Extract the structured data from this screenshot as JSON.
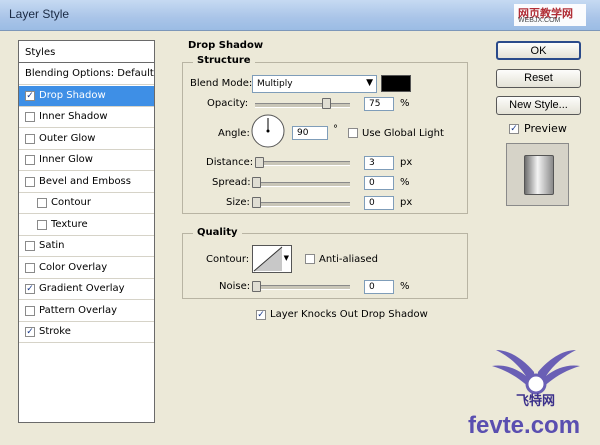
{
  "window": {
    "title": "Layer Style"
  },
  "watermark": {
    "top_line1": "网页教学网",
    "top_line2": "WEBJX.COM",
    "bottom_text": "fevte.com",
    "bottom_cn": "飞特网"
  },
  "styles_panel": {
    "header": "Styles",
    "items": [
      {
        "label": "Blending Options: Default",
        "checkbox": false,
        "checked": false,
        "indent": false,
        "selected": false
      },
      {
        "label": "Drop Shadow",
        "checkbox": true,
        "checked": true,
        "indent": false,
        "selected": true
      },
      {
        "label": "Inner Shadow",
        "checkbox": true,
        "checked": false,
        "indent": false,
        "selected": false
      },
      {
        "label": "Outer Glow",
        "checkbox": true,
        "checked": false,
        "indent": false,
        "selected": false
      },
      {
        "label": "Inner Glow",
        "checkbox": true,
        "checked": false,
        "indent": false,
        "selected": false
      },
      {
        "label": "Bevel and Emboss",
        "checkbox": true,
        "checked": false,
        "indent": false,
        "selected": false
      },
      {
        "label": "Contour",
        "checkbox": true,
        "checked": false,
        "indent": true,
        "selected": false
      },
      {
        "label": "Texture",
        "checkbox": true,
        "checked": false,
        "indent": true,
        "selected": false
      },
      {
        "label": "Satin",
        "checkbox": true,
        "checked": false,
        "indent": false,
        "selected": false
      },
      {
        "label": "Color Overlay",
        "checkbox": true,
        "checked": false,
        "indent": false,
        "selected": false
      },
      {
        "label": "Gradient Overlay",
        "checkbox": true,
        "checked": true,
        "indent": false,
        "selected": false
      },
      {
        "label": "Pattern Overlay",
        "checkbox": true,
        "checked": false,
        "indent": false,
        "selected": false
      },
      {
        "label": "Stroke",
        "checkbox": true,
        "checked": true,
        "indent": false,
        "selected": false
      }
    ]
  },
  "drop_shadow": {
    "section_title": "Drop Shadow",
    "structure_title": "Structure",
    "blend_mode_label": "Blend Mode:",
    "blend_mode_value": "Multiply",
    "shadow_color": "#000000",
    "opacity_label": "Opacity:",
    "opacity_value": "75",
    "opacity_unit": "%",
    "opacity_level": 0.75,
    "angle_label": "Angle:",
    "angle_value": "90",
    "angle_unit": "°",
    "use_global_light_label": "Use Global Light",
    "use_global_light_checked": false,
    "distance_label": "Distance:",
    "distance_value": "3",
    "distance_unit": "px",
    "spread_label": "Spread:",
    "spread_value": "0",
    "spread_unit": "%",
    "size_label": "Size:",
    "size_value": "0",
    "size_unit": "px",
    "quality_title": "Quality",
    "contour_label": "Contour:",
    "anti_aliased_label": "Anti-aliased",
    "anti_aliased_checked": false,
    "noise_label": "Noise:",
    "noise_value": "0",
    "noise_unit": "%",
    "knockout_label": "Layer Knocks Out Drop Shadow",
    "knockout_checked": true
  },
  "buttons": {
    "ok": "OK",
    "reset": "Reset",
    "new_style": "New Style..."
  },
  "preview": {
    "label": "Preview",
    "checked": true
  }
}
